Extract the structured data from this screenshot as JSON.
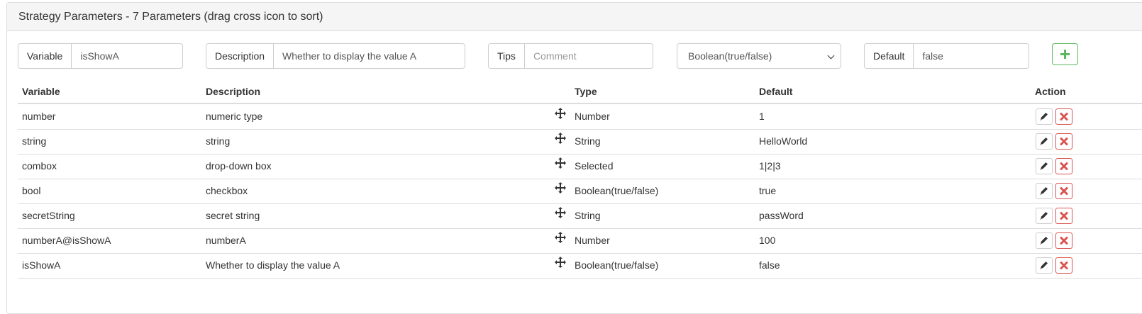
{
  "panel": {
    "title": "Strategy Parameters - 7 Parameters (drag cross icon to sort)"
  },
  "form": {
    "variable": {
      "label": "Variable",
      "value": "isShowA"
    },
    "description": {
      "label": "Description",
      "value": "Whether to display the value A"
    },
    "tips": {
      "label": "Tips",
      "placeholder": "Comment"
    },
    "type_select": {
      "selected": "Boolean(true/false)"
    },
    "default": {
      "label": "Default",
      "value": "false"
    },
    "add_icon": "plus-icon"
  },
  "table": {
    "headers": {
      "variable": "Variable",
      "description": "Description",
      "type": "Type",
      "default": "Default",
      "action": "Action"
    },
    "rows": [
      {
        "variable": "number",
        "description": "numeric type",
        "type": "Number",
        "default": "1"
      },
      {
        "variable": "string",
        "description": "string",
        "type": "String",
        "default": "HelloWorld"
      },
      {
        "variable": "combox",
        "description": "drop-down box",
        "type": "Selected",
        "default": "1|2|3"
      },
      {
        "variable": "bool",
        "description": "checkbox",
        "type": "Boolean(true/false)",
        "default": "true"
      },
      {
        "variable": "secretString",
        "description": "secret string",
        "type": "String",
        "default": "passWord"
      },
      {
        "variable": "numberA@isShowA",
        "description": "numberA",
        "type": "Number",
        "default": "100"
      },
      {
        "variable": "isShowA",
        "description": "Whether to display the value A",
        "type": "Boolean(true/false)",
        "default": "false"
      }
    ]
  },
  "icons": {
    "move": "move-icon",
    "edit": "pencil-icon",
    "delete": "close-icon"
  },
  "colors": {
    "add": "#5cb85c",
    "delete": "#d9534f",
    "border": "#dddddd"
  }
}
